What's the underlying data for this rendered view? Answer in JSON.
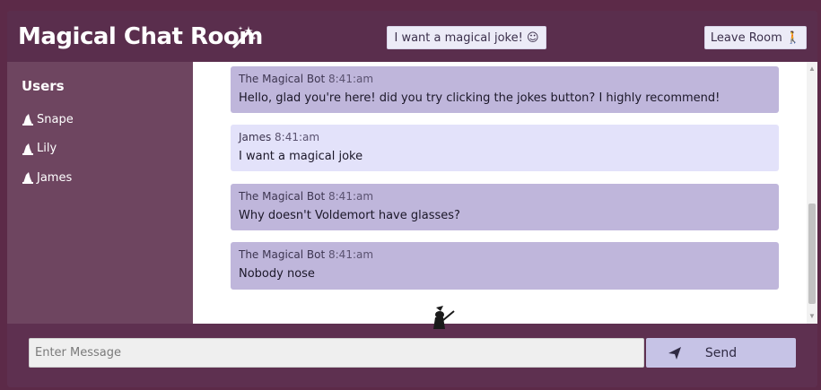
{
  "header": {
    "title": "Magical Chat Room",
    "joke_button": "I want a magical joke! ☺",
    "leave_button": "Leave Room 🚶"
  },
  "sidebar": {
    "title": "Users",
    "users": [
      "Snape",
      "Lily",
      "James"
    ]
  },
  "messages": [
    {
      "sender": "The Magical Bot",
      "time": "8:41:am",
      "text": "Hello, glad you're here! did you try clicking the jokes button? I highly recommend!",
      "kind": "bot"
    },
    {
      "sender": "James",
      "time": "8:41:am",
      "text": "I want a magical joke",
      "kind": "me"
    },
    {
      "sender": "The Magical Bot",
      "time": "8:41:am",
      "text": "Why doesn't Voldemort have glasses?",
      "kind": "bot"
    },
    {
      "sender": "The Magical Bot",
      "time": "8:41:am",
      "text": "Nobody nose",
      "kind": "bot"
    }
  ],
  "composer": {
    "placeholder": "Enter Message",
    "send_label": "Send"
  },
  "colors": {
    "header_bg": "#5a2e4d",
    "sidebar_bg": "#6e4560",
    "bot_bubble": "#bfb6db",
    "user_bubble": "#e3e2fa",
    "send_button": "#c6c3e6"
  }
}
